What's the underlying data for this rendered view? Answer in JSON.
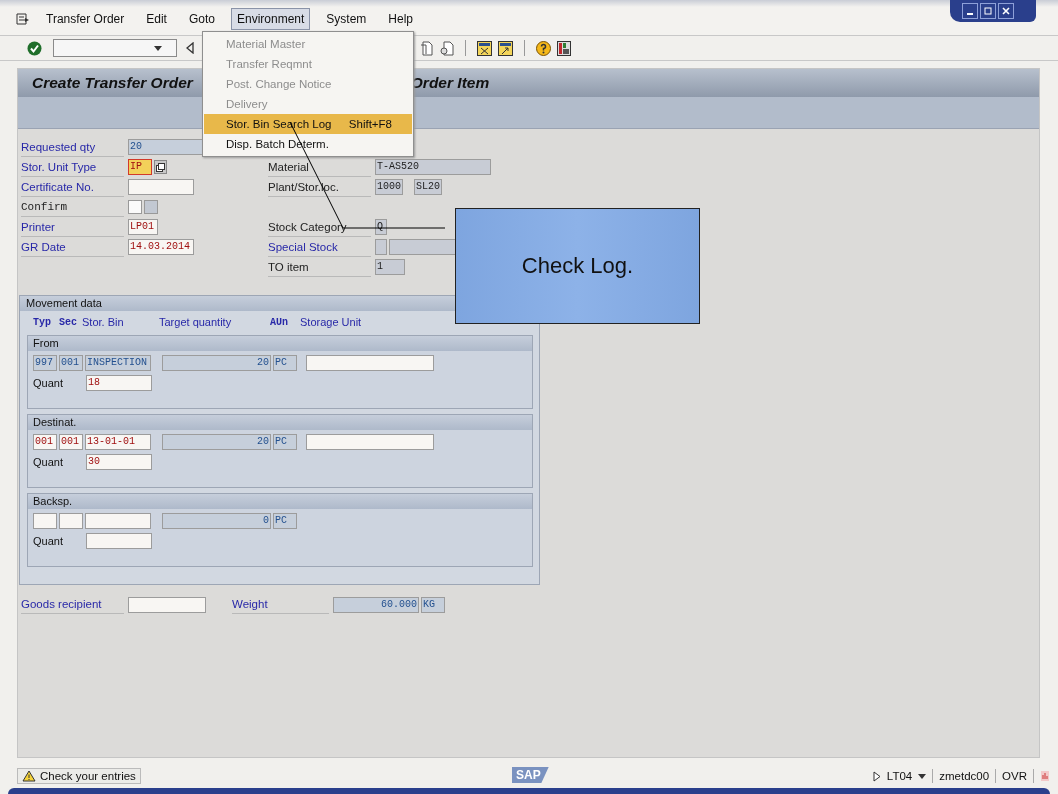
{
  "menu_bar": [
    {
      "label": "Transfer Order",
      "selected": false
    },
    {
      "label": "Edit",
      "selected": false
    },
    {
      "label": "Goto",
      "selected": false
    },
    {
      "label": "Environment",
      "selected": true
    },
    {
      "label": "System",
      "selected": false
    },
    {
      "label": "Help",
      "selected": false
    }
  ],
  "environment_menu": [
    {
      "label": "Material Master",
      "disabled": true,
      "selected": false
    },
    {
      "label": "Transfer Reqmnt",
      "disabled": true,
      "selected": false
    },
    {
      "label": "Post. Change Notice",
      "disabled": true,
      "selected": false
    },
    {
      "label": "Delivery",
      "disabled": true,
      "selected": false
    },
    {
      "label": "Stor. Bin Search Log",
      "shortcut": "Shift+F8",
      "disabled": false,
      "selected": true
    },
    {
      "label": "Disp. Batch Determ.",
      "disabled": false,
      "selected": false
    }
  ],
  "title_parts": [
    "Create Transfer Order",
    "Order Item"
  ],
  "left_fields": [
    {
      "label": "Requested qty",
      "kind": "blue",
      "fields": [
        {
          "value": "20",
          "kind": "output"
        }
      ]
    },
    {
      "label": "Stor. Unit Type",
      "kind": "blue",
      "fields": [
        {
          "value": "IP",
          "kind": "focus"
        },
        {
          "kind": "button"
        }
      ]
    },
    {
      "label": "Certificate No.",
      "kind": "blue",
      "fields": [
        {
          "kind": "input"
        }
      ]
    },
    {
      "label": "Confirm",
      "kind": "mono",
      "fields": [
        {
          "kind": "checkbox",
          "disabled": false
        },
        {
          "kind": "checkbox",
          "disabled": true
        }
      ]
    },
    {
      "label": "Printer",
      "kind": "blue",
      "fields": [
        {
          "value": "LP01",
          "kind": "input"
        }
      ]
    },
    {
      "label": "GR Date",
      "kind": "blue",
      "fields": [
        {
          "value": "14.03.2014",
          "kind": "input"
        }
      ]
    }
  ],
  "right_fields": [
    {
      "label": "Material",
      "kind": "plain",
      "fields": [
        {
          "value": "T-AS520",
          "kind": "display"
        }
      ]
    },
    {
      "label": "Plant/Stor.loc.",
      "kind": "plain",
      "fields": [
        {
          "value": "1000",
          "kind": "display"
        },
        {
          "value": "SL20",
          "kind": "display"
        }
      ]
    },
    {
      "label": "Stock Category",
      "kind": "plain",
      "fields": [
        {
          "value": "Q",
          "kind": "display"
        }
      ]
    },
    {
      "label": "Special Stock",
      "kind": "blue",
      "fields": [
        {
          "kind": "display"
        },
        {
          "kind": "display"
        }
      ]
    },
    {
      "label": "TO item",
      "kind": "plain",
      "fields": [
        {
          "value": "1",
          "kind": "display"
        }
      ]
    }
  ],
  "movement_data": {
    "title": "Movement data",
    "columns": [
      "Typ",
      "Sec",
      "Stor. Bin",
      "Target quantity",
      "AUn",
      "Storage Unit"
    ],
    "sections": [
      {
        "title": "From",
        "bin": [
          {
            "value": "997",
            "kind": "output"
          },
          {
            "value": "001",
            "kind": "output"
          },
          {
            "value": "INSPECTION",
            "kind": "output"
          }
        ],
        "target_quantity": {
          "value": "20",
          "kind": "output"
        },
        "unit": {
          "value": "PC",
          "kind": "output"
        },
        "storage_unit": {
          "kind": "input"
        },
        "quant_label": "Quant",
        "quant": {
          "value": "18",
          "kind": "input"
        }
      },
      {
        "title": "Destinat.",
        "bin": [
          {
            "value": "001",
            "kind": "input"
          },
          {
            "value": "001",
            "kind": "input"
          },
          {
            "value": "13-01-01",
            "kind": "input"
          }
        ],
        "target_quantity": {
          "value": "20",
          "kind": "output"
        },
        "unit": {
          "value": "PC",
          "kind": "output"
        },
        "storage_unit": {
          "kind": "input"
        },
        "quant_label": "Quant",
        "quant": {
          "value": "30",
          "kind": "input"
        }
      },
      {
        "title": "Backsp.",
        "bin": [
          {
            "kind": "input"
          },
          {
            "kind": "input"
          },
          {
            "kind": "input"
          }
        ],
        "target_quantity": {
          "value": "0",
          "kind": "output"
        },
        "unit": {
          "value": "PC",
          "kind": "output"
        },
        "quant_label": "Quant",
        "quant": {
          "kind": "input"
        }
      }
    ]
  },
  "goods_recipient": {
    "label": "Goods recipient",
    "field": {
      "kind": "input"
    }
  },
  "weight": {
    "label": "Weight",
    "value": {
      "value": "60.000",
      "kind": "output"
    },
    "unit": {
      "value": "KG",
      "kind": "output"
    }
  },
  "callout": "Check Log.",
  "status_bar": {
    "message": "Check your entries",
    "logo": "SAP",
    "transaction": "LT04",
    "server": "zmetdc00",
    "mode": "OVR"
  }
}
